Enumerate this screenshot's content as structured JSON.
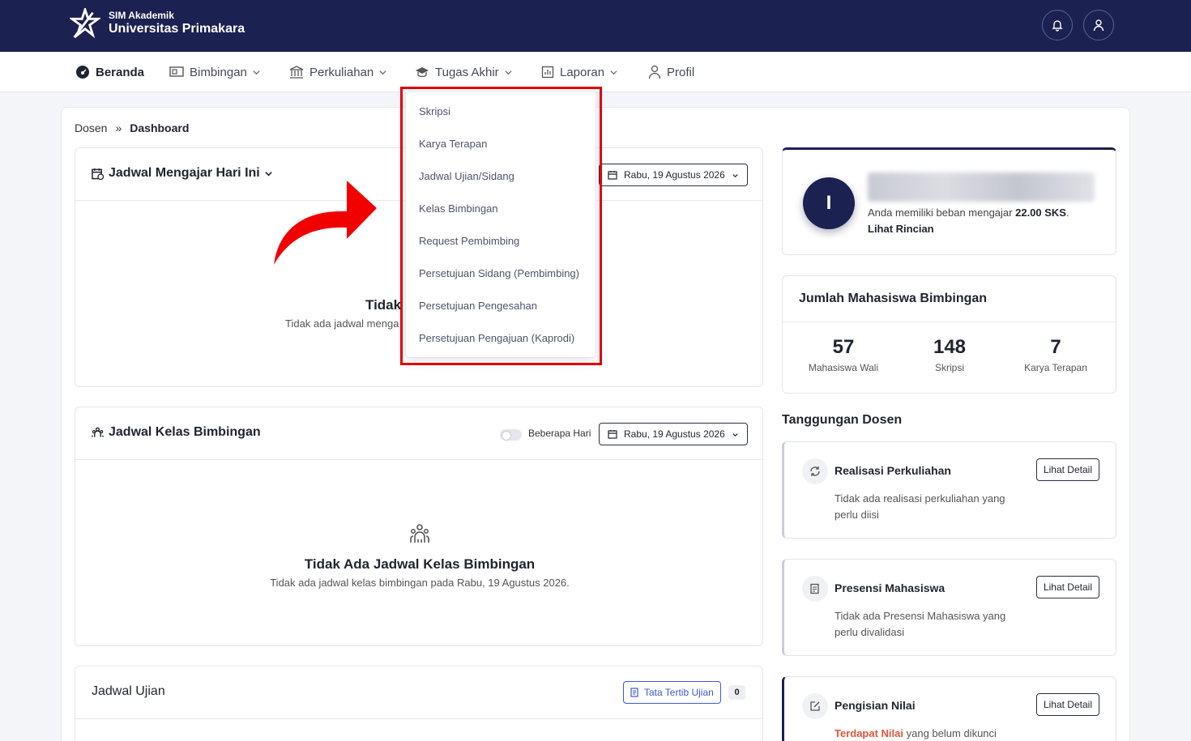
{
  "header": {
    "app_subtitle": "SIM Akademik",
    "app_title": "Universitas Primakara",
    "icons": [
      "bell-icon",
      "user-icon"
    ]
  },
  "nav": {
    "items": [
      {
        "label": "Beranda",
        "icon": "dashboard-icon",
        "active": true
      },
      {
        "label": "Bimbingan",
        "icon": "presentation-icon"
      },
      {
        "label": "Perkuliahan",
        "icon": "building-icon"
      },
      {
        "label": "Tugas Akhir",
        "icon": "graduation-cap-icon"
      },
      {
        "label": "Laporan",
        "icon": "report-icon"
      },
      {
        "label": "Profil",
        "icon": "user-icon"
      }
    ]
  },
  "breadcrumb": {
    "root": "Dosen",
    "separator": "»",
    "current": "Dashboard"
  },
  "dropdown": {
    "items": [
      "Skripsi",
      "Karya Terapan",
      "Jadwal Ujian/Sidang",
      "Kelas Bimbingan",
      "Request Pembimbing",
      "Persetujuan Sidang (Pembimbing)",
      "Persetujuan Pengesahan",
      "Persetujuan Pengajuan (Kaprodi)"
    ]
  },
  "jadwal_mengajar": {
    "title": "Jadwal Mengajar Hari Ini",
    "date": "Rabu, 19 Agustus 2026",
    "empty_title_partial": "Tidak",
    "empty_sub_partial": "Tidak ada jadwal menga"
  },
  "jadwal_kelas": {
    "title": "Jadwal Kelas Bimbingan",
    "toggle_label": "Beberapa Hari",
    "date": "Rabu, 19 Agustus 2026",
    "empty_title": "Tidak Ada Jadwal Kelas Bimbingan",
    "empty_sub": "Tidak ada jadwal kelas bimbingan pada Rabu, 19 Agustus 2026."
  },
  "jadwal_ujian": {
    "title": "Jadwal Ujian",
    "rules_button": "Tata Tertib Ujian",
    "count": "0"
  },
  "profile": {
    "initial": "I",
    "load_prefix": "Anda memiliki beban mengajar",
    "load_value": "22.00 SKS",
    "load_suffix": ".",
    "link": "Lihat Rincian"
  },
  "mahasiswa": {
    "title": "Jumlah Mahasiswa Bimbingan",
    "stats": [
      {
        "value": "57",
        "label": "Mahasiswa Wali"
      },
      {
        "value": "148",
        "label": "Skripsi"
      },
      {
        "value": "7",
        "label": "Karya Terapan"
      }
    ]
  },
  "tanggungan": {
    "title": "Tanggungan Dosen",
    "items": [
      {
        "title": "Realisasi Perkuliahan",
        "body": "Tidak ada realisasi perkuliahan yang perlu diisi",
        "button": "Lihat Detail"
      },
      {
        "title": "Presensi Mahasiswa",
        "body": "Tidak ada Presensi Mahasiswa yang perlu divalidasi",
        "button": "Lihat Detail"
      },
      {
        "title": "Pengisian Nilai",
        "body_highlight": "Terdapat Nilai",
        "body_rest": " yang belum dikunci",
        "button": "Lihat Detail"
      }
    ]
  },
  "colors": {
    "navy": "#1b2150",
    "highlight_red": "#e10000",
    "link_blue": "#3f58d6"
  }
}
